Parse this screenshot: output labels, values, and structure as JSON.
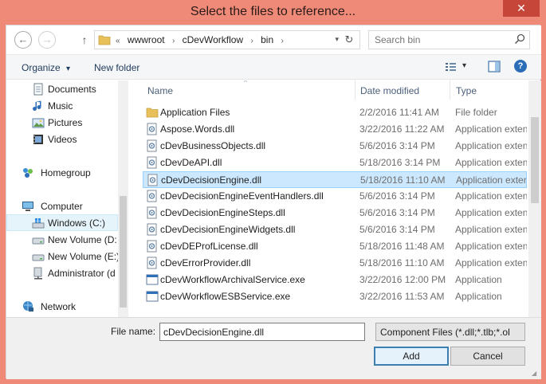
{
  "window": {
    "title": "Select the files to reference...",
    "close_glyph": "✕",
    "frame_color": "#f08a78"
  },
  "nav": {
    "back_glyph": "←",
    "forward_glyph": "→",
    "up_glyph": "↑",
    "breadcrumb_lead": "«",
    "breadcrumb": [
      "wwwroot",
      "cDevWorkflow",
      "bin"
    ],
    "crumb_sep": "›",
    "refresh_glyph": "↻",
    "dropdown_glyph": "▾",
    "search_placeholder": "Search bin"
  },
  "toolbar": {
    "organize_label": "Organize",
    "organize_arrow": "▾",
    "new_folder_label": "New folder",
    "view_arrow": "▾",
    "help_glyph": "?"
  },
  "navpane": {
    "items": [
      {
        "label": "Documents",
        "icon": "documents-icon"
      },
      {
        "label": "Music",
        "icon": "music-icon"
      },
      {
        "label": "Pictures",
        "icon": "pictures-icon"
      },
      {
        "label": "Videos",
        "icon": "videos-icon"
      },
      {
        "label": "Homegroup",
        "icon": "homegroup-icon"
      },
      {
        "label": "Computer",
        "icon": "computer-icon"
      },
      {
        "label": "Windows (C:)",
        "icon": "drive-icon"
      },
      {
        "label": "New Volume (D:",
        "icon": "drive-icon"
      },
      {
        "label": "New Volume (E:)",
        "icon": "drive-icon"
      },
      {
        "label": "Administrator (d",
        "icon": "network-drive-icon"
      },
      {
        "label": "Network",
        "icon": "network-icon"
      }
    ]
  },
  "filelist": {
    "columns": [
      "Name",
      "Date modified",
      "Type"
    ],
    "sort_glyph": "^",
    "rows": [
      {
        "name": "Application Files",
        "date": "2/2/2016 11:41 AM",
        "type": "File folder",
        "icon": "folder-icon"
      },
      {
        "name": "Aspose.Words.dll",
        "date": "3/22/2016 11:22 AM",
        "type": "Application extens",
        "icon": "dll-icon"
      },
      {
        "name": "cDevBusinessObjects.dll",
        "date": "5/6/2016 3:14 PM",
        "type": "Application extens",
        "icon": "dll-icon"
      },
      {
        "name": "cDevDeAPI.dll",
        "date": "5/18/2016 3:14 PM",
        "type": "Application extens",
        "icon": "dll-icon"
      },
      {
        "name": "cDevDecisionEngine.dll",
        "date": "5/18/2016 11:10 AM",
        "type": "Application extens",
        "icon": "dll-icon",
        "selected": true
      },
      {
        "name": "cDevDecisionEngineEventHandlers.dll",
        "date": "5/6/2016 3:14 PM",
        "type": "Application extens",
        "icon": "dll-icon"
      },
      {
        "name": "cDevDecisionEngineSteps.dll",
        "date": "5/6/2016 3:14 PM",
        "type": "Application extens",
        "icon": "dll-icon"
      },
      {
        "name": "cDevDecisionEngineWidgets.dll",
        "date": "5/6/2016 3:14 PM",
        "type": "Application extens",
        "icon": "dll-icon"
      },
      {
        "name": "cDevDEProfLicense.dll",
        "date": "5/18/2016 11:48 AM",
        "type": "Application extens",
        "icon": "dll-icon"
      },
      {
        "name": "cDevErrorProvider.dll",
        "date": "5/18/2016 11:10 AM",
        "type": "Application extens",
        "icon": "dll-icon"
      },
      {
        "name": "cDevWorkflowArchivalService.exe",
        "date": "3/22/2016 12:00 PM",
        "type": "Application",
        "icon": "exe-icon"
      },
      {
        "name": "cDevWorkflowESBService.exe",
        "date": "3/22/2016 11:53 AM",
        "type": "Application",
        "icon": "exe-icon"
      }
    ]
  },
  "bottom": {
    "file_name_label": "File name:",
    "file_name_value": "cDevDecisionEngine.dll",
    "filter_value": "Component Files (*.dll;*.tlb;*.ol",
    "add_label": "Add",
    "cancel_label": "Cancel"
  }
}
